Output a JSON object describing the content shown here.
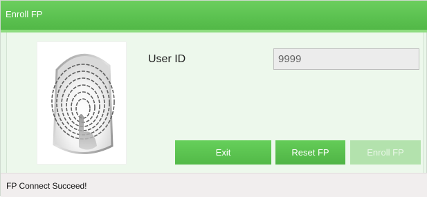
{
  "window": {
    "title": "Enroll FP"
  },
  "form": {
    "user_id_label": "User ID",
    "user_id_value": "9999"
  },
  "buttons": {
    "exit_label": "Exit",
    "reset_label": "Reset FP",
    "enroll_label": "Enroll FP"
  },
  "status": {
    "text": "FP Connect Succeed!"
  },
  "icons": {
    "fingerprint": "fingerprint-icon"
  },
  "colors": {
    "accent": "#5cc251",
    "accent_light": "#8ddc7f",
    "button_disabled": "#b3e2ad",
    "background": "#e9f6e9",
    "statusbar": "#f1eeee"
  }
}
